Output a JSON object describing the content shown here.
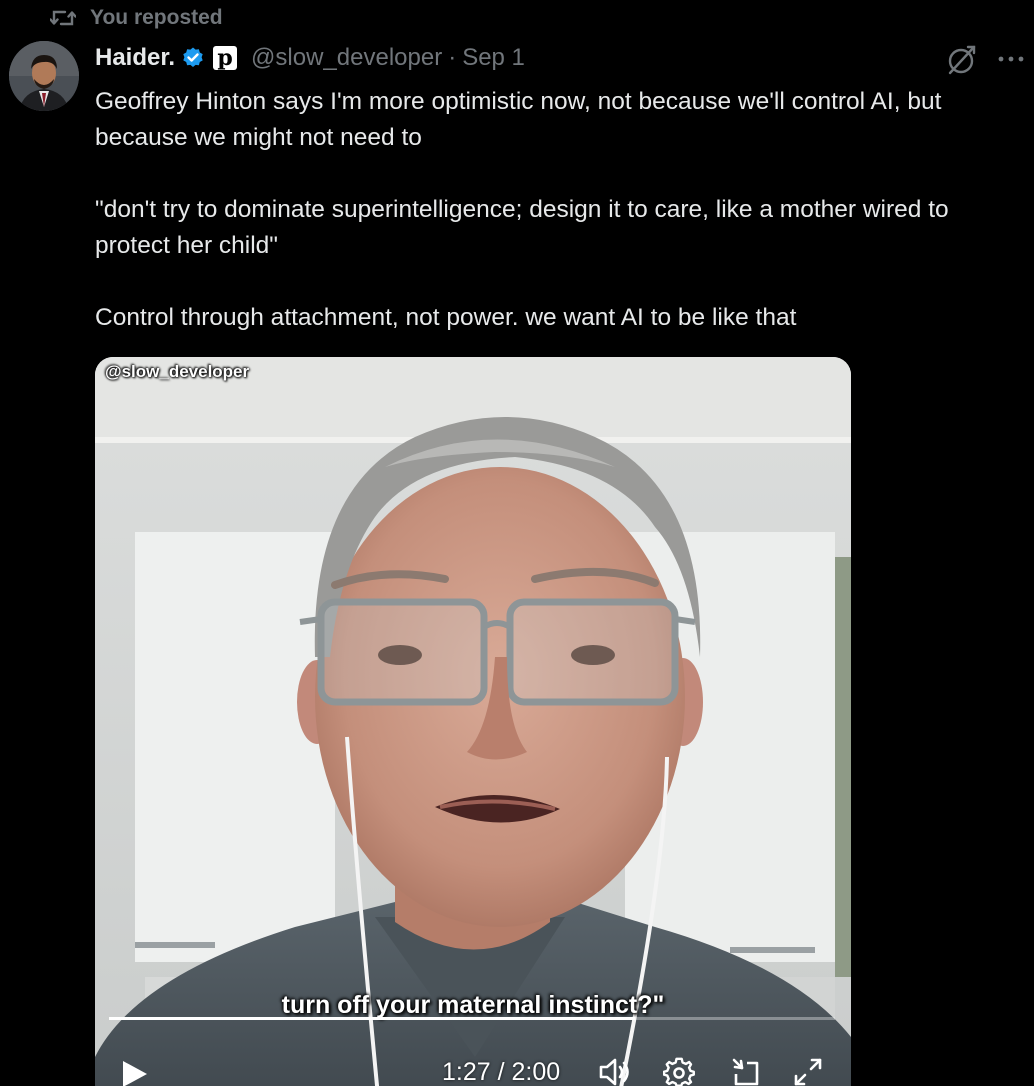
{
  "repost": {
    "label": "You reposted",
    "icon": "repost-icon"
  },
  "author": {
    "display_name": "Haider.",
    "verified": true,
    "affiliation_badge": "p",
    "handle": "@slow_developer",
    "separator": "·",
    "date": "Sep 1"
  },
  "actions": {
    "grok_icon": "grok-icon",
    "more_icon": "more-icon"
  },
  "tweet": {
    "paragraphs": [
      "Geoffrey Hinton says I'm more optimistic now, not because we'll control AI, but because we might not need to",
      "\"don't try to dominate superintelligence; design it to care, like a mother wired to protect her child\"",
      "Control through attachment, not power. we want AI to be like that"
    ]
  },
  "video": {
    "watermark": "@slow_developer",
    "caption": "turn off your maternal instinct?\"",
    "current_time": "1:27",
    "duration": "2:00",
    "time_display": "1:27 / 2:00",
    "progress_fraction": 0.725,
    "controls": [
      "play-icon",
      "volume-icon",
      "settings-icon",
      "picture-in-picture-icon",
      "fullscreen-icon"
    ]
  },
  "colors": {
    "background": "#000000",
    "text_primary": "#e7e9ea",
    "text_secondary": "#71767b",
    "verified_blue": "#1d9bf0"
  }
}
